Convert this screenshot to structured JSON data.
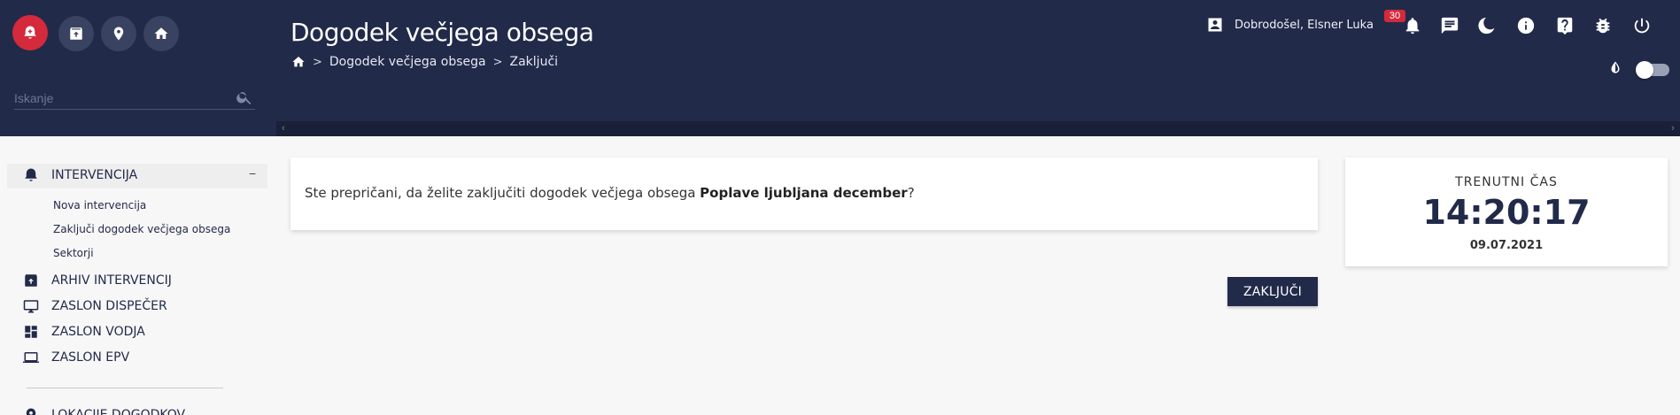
{
  "header": {
    "title": "Dogodek večjega obsega",
    "breadcrumb": [
      "Dogodek večjega obsega",
      "Zaključi"
    ],
    "user_greeting": "Dobrodošel, Elsner Luka",
    "notification_count": "30",
    "search_placeholder": "Iskanje",
    "quick_icons": [
      "alarm-bell-icon",
      "archive-icon",
      "location-pin-icon",
      "home-icon"
    ],
    "top_icons": [
      "notifications-icon",
      "messages-icon",
      "dark-mode-icon",
      "info-icon",
      "help-icon",
      "bug-icon",
      "power-icon"
    ],
    "theme_toggle": false
  },
  "sidebar": {
    "items": [
      {
        "label": "INTERVENCIJA",
        "icon": "alarm-bell-icon",
        "expanded": true,
        "collapse_symbol": "−"
      },
      {
        "label": "ARHIV INTERVENCIJ",
        "icon": "archive-icon"
      },
      {
        "label": "ZASLON DISPEČER",
        "icon": "monitor-icon"
      },
      {
        "label": "ZASLON VODJA",
        "icon": "dashboard-icon"
      },
      {
        "label": "ZASLON EPV",
        "icon": "laptop-icon"
      },
      {
        "label": "LOKACIJE DOGODKOV",
        "icon": "location-pin-icon"
      }
    ],
    "sub_items": [
      "Nova intervencija",
      "Zaključi dogodek večjega obsega",
      "Sektorji"
    ]
  },
  "main": {
    "question_prefix": "Ste prepričani, da želite zaključiti dogodek večjega obsega ",
    "event_name": "Poplave ljubljana december",
    "question_suffix": "?",
    "confirm_label": "ZAKLJUČI"
  },
  "clock": {
    "label": "TRENUTNI ČAS",
    "time": "14:20:17",
    "date": "09.07.2021"
  },
  "colors": {
    "header_bg": "#222a4a",
    "accent_red": "#d42a3c",
    "button_bg": "#222a4a",
    "page_bg": "#f7f7f7"
  }
}
